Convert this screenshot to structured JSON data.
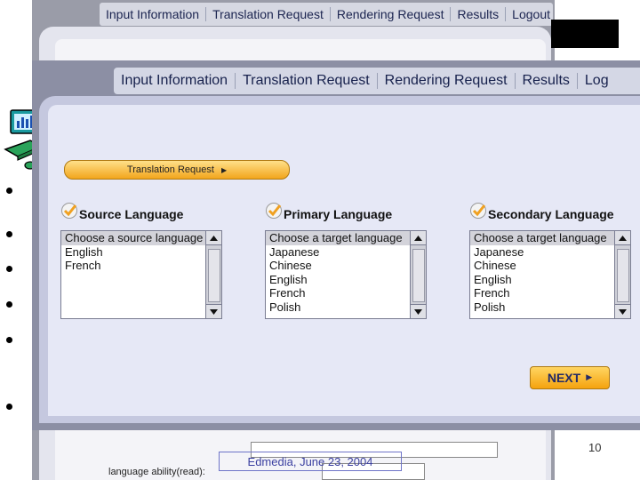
{
  "background": {
    "nav": [
      "Input Information",
      "Translation Request",
      "Rendering Request",
      "Results",
      "Logout"
    ],
    "field_label": "language ability(read):"
  },
  "foreground": {
    "nav": [
      "Input Information",
      "Translation Request",
      "Rendering Request",
      "Results",
      "Log"
    ],
    "section_button": "Translation Request",
    "columns": [
      {
        "label": "Source Language",
        "options": [
          "Choose a source language",
          "English",
          "French"
        ]
      },
      {
        "label": "Primary Language",
        "options": [
          "Choose a target language",
          "Japanese",
          "Chinese",
          "English",
          "French",
          "Polish"
        ]
      },
      {
        "label": "Secondary Language",
        "options": [
          "Choose a target language",
          "Japanese",
          "Chinese",
          "English",
          "French",
          "Polish"
        ]
      }
    ],
    "next_button": "NEXT"
  },
  "slide": {
    "footer": "Edmedia, June 23, 2004",
    "page_number": "10"
  },
  "colors": {
    "button_orange": "#f5a30e",
    "panel_blue": "#c5c8df",
    "nav_text": "#16204c"
  },
  "icons": [
    "computer-chart-icon",
    "checkmark-icon",
    "scroll-up-icon",
    "scroll-down-icon",
    "play-arrow-icon"
  ]
}
